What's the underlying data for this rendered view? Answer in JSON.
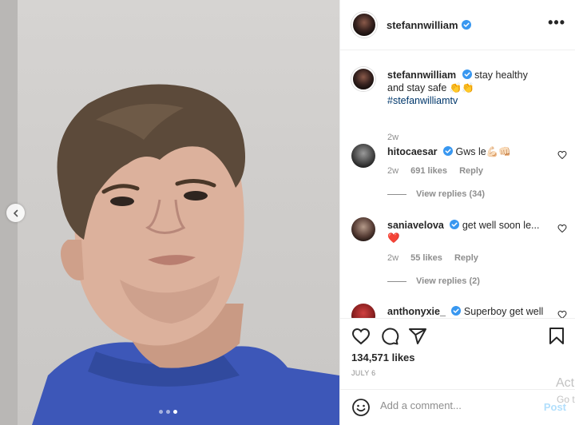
{
  "post": {
    "author": "stefannwilliam",
    "caption": "stay healthy and stay safe 👏👏",
    "hashtag": "#stefanwilliamtv",
    "caption_time": "2w",
    "likes": "134,571 likes",
    "date": "JULY 6",
    "carousel": {
      "dots": 3,
      "active_index": 2
    }
  },
  "comments": [
    {
      "user": "hitocaesar",
      "text": "Gws le💪🏻👊🏻",
      "time": "2w",
      "likes": "691 likes",
      "reply": "Reply",
      "view_replies": "View replies (34)"
    },
    {
      "user": "saniavelova",
      "text": "get well soon le... ❤️",
      "time": "2w",
      "likes": "55 likes",
      "reply": "Reply",
      "view_replies": "View replies (2)"
    },
    {
      "user": "anthonyxie_",
      "text": "Superboy get well"
    }
  ],
  "add_comment": {
    "placeholder": "Add a comment...",
    "post_label": "Post"
  },
  "header": {
    "more": "•••"
  },
  "watermark": {
    "line1": "Act",
    "line2": "Go t"
  },
  "colors": {
    "verified": "#3897f0",
    "link": "#00376b",
    "heart": "#ed4956",
    "post_button": "#b2dffc"
  },
  "icons": [
    "heart-icon",
    "comment-icon",
    "share-icon",
    "bookmark-icon",
    "emoji-icon",
    "chevron-left-icon",
    "verified-icon",
    "more-icon"
  ]
}
